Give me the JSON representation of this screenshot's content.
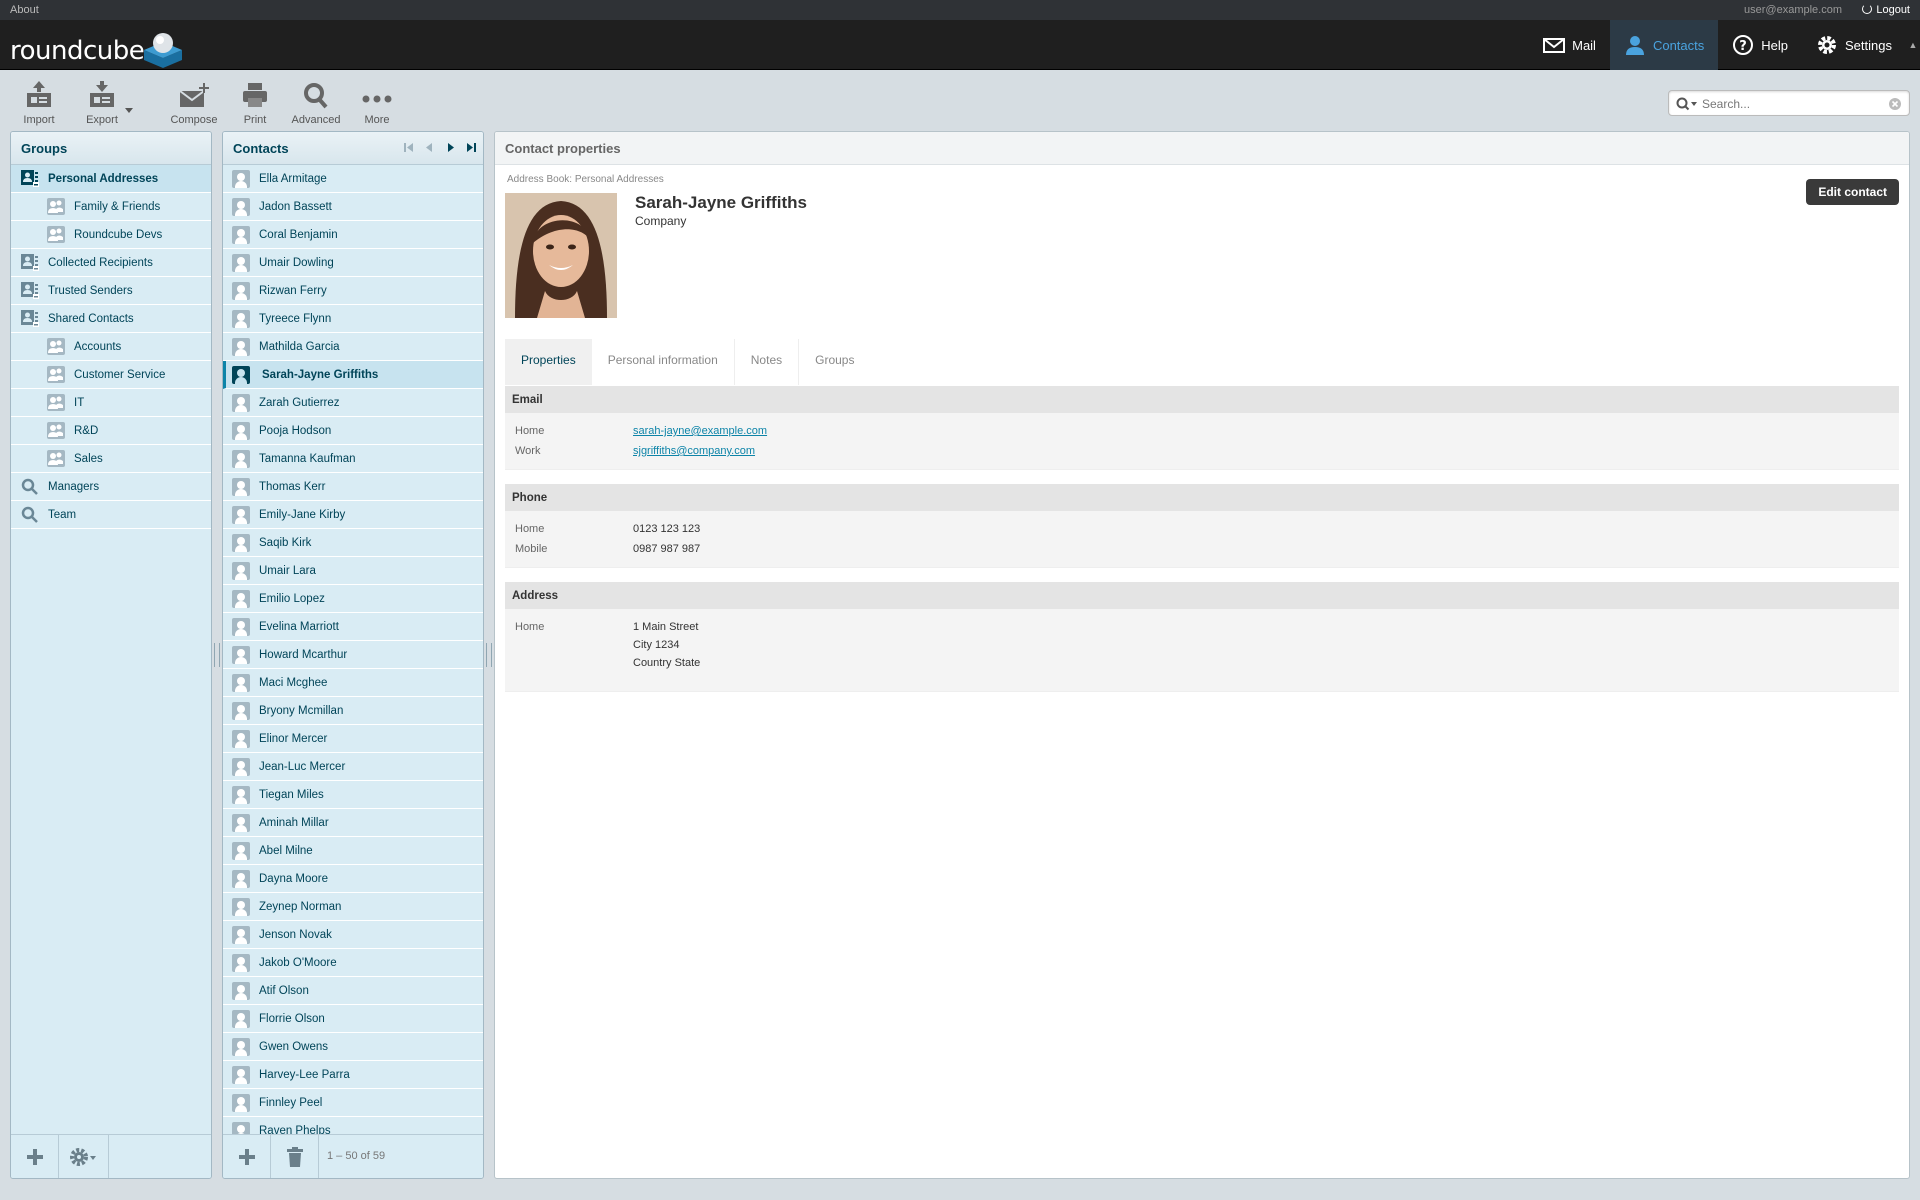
{
  "topline": {
    "about": "About",
    "user": "user@example.com",
    "logout": "Logout"
  },
  "logo": {
    "text": "roundcube"
  },
  "nav": {
    "mail": "Mail",
    "contacts": "Contacts",
    "help": "Help",
    "settings": "Settings"
  },
  "toolbar": {
    "import": "Import",
    "export": "Export",
    "compose": "Compose",
    "print": "Print",
    "advanced": "Advanced",
    "more": "More"
  },
  "search": {
    "placeholder": "Search..."
  },
  "groups": {
    "title": "Groups",
    "items": [
      {
        "label": "Personal Addresses",
        "icon": "addressbook-icon",
        "level": 0,
        "selected": true
      },
      {
        "label": "Family & Friends",
        "icon": "group-icon",
        "level": 1
      },
      {
        "label": "Roundcube Devs",
        "icon": "group-icon",
        "level": 1
      },
      {
        "label": "Collected Recipients",
        "icon": "addressbook-icon",
        "level": 0
      },
      {
        "label": "Trusted Senders",
        "icon": "addressbook-icon",
        "level": 0
      },
      {
        "label": "Shared Contacts",
        "icon": "addressbook-icon",
        "level": 0
      },
      {
        "label": "Accounts",
        "icon": "group-icon",
        "level": 1
      },
      {
        "label": "Customer Service",
        "icon": "group-icon",
        "level": 1
      },
      {
        "label": "IT",
        "icon": "group-icon",
        "level": 1
      },
      {
        "label": "R&D",
        "icon": "group-icon",
        "level": 1
      },
      {
        "label": "Sales",
        "icon": "group-icon",
        "level": 1
      },
      {
        "label": "Managers",
        "icon": "search-icon",
        "level": 0
      },
      {
        "label": "Team",
        "icon": "search-icon",
        "level": 0
      }
    ]
  },
  "contacts": {
    "title": "Contacts",
    "count": "1 – 50 of 59",
    "items": [
      "Ella Armitage",
      "Jadon Bassett",
      "Coral Benjamin",
      "Umair Dowling",
      "Rizwan Ferry",
      "Tyreece Flynn",
      "Mathilda Garcia",
      "Sarah-Jayne Griffiths",
      "Zarah Gutierrez",
      "Pooja Hodson",
      "Tamanna Kaufman",
      "Thomas Kerr",
      "Emily-Jane Kirby",
      "Saqib Kirk",
      "Umair Lara",
      "Emilio Lopez",
      "Evelina Marriott",
      "Howard Mcarthur",
      "Maci Mcghee",
      "Bryony Mcmillan",
      "Elinor Mercer",
      "Jean-Luc Mercer",
      "Tiegan Miles",
      "Aminah Millar",
      "Abel Milne",
      "Dayna Moore",
      "Zeynep Norman",
      "Jenson Novak",
      "Jakob O'Moore",
      "Atif Olson",
      "Florrie Olson",
      "Gwen Owens",
      "Harvey-Lee Parra",
      "Finnley Peel",
      "Raven Phelps"
    ],
    "selected_index": 7
  },
  "detail": {
    "title": "Contact properties",
    "address_book": "Address Book: Personal Addresses",
    "name": "Sarah-Jayne Griffiths",
    "company": "Company",
    "edit_button": "Edit contact",
    "tabs": [
      "Properties",
      "Personal information",
      "Notes",
      "Groups"
    ],
    "email": {
      "heading": "Email",
      "rows": [
        {
          "label": "Home",
          "value": "sarah-jayne@example.com"
        },
        {
          "label": "Work",
          "value": "sjgriffiths@company.com"
        }
      ]
    },
    "phone": {
      "heading": "Phone",
      "rows": [
        {
          "label": "Home",
          "value": "0123 123 123"
        },
        {
          "label": "Mobile",
          "value": "0987 987 987"
        }
      ]
    },
    "address": {
      "heading": "Address",
      "label": "Home",
      "lines": [
        "1 Main Street",
        "City 1234",
        "Country State"
      ]
    }
  },
  "colors": {
    "accent": "#0d84a8",
    "panel": "#d9ecf4",
    "header": "#1f1f1f",
    "selected_nav": "#4aa3df"
  }
}
